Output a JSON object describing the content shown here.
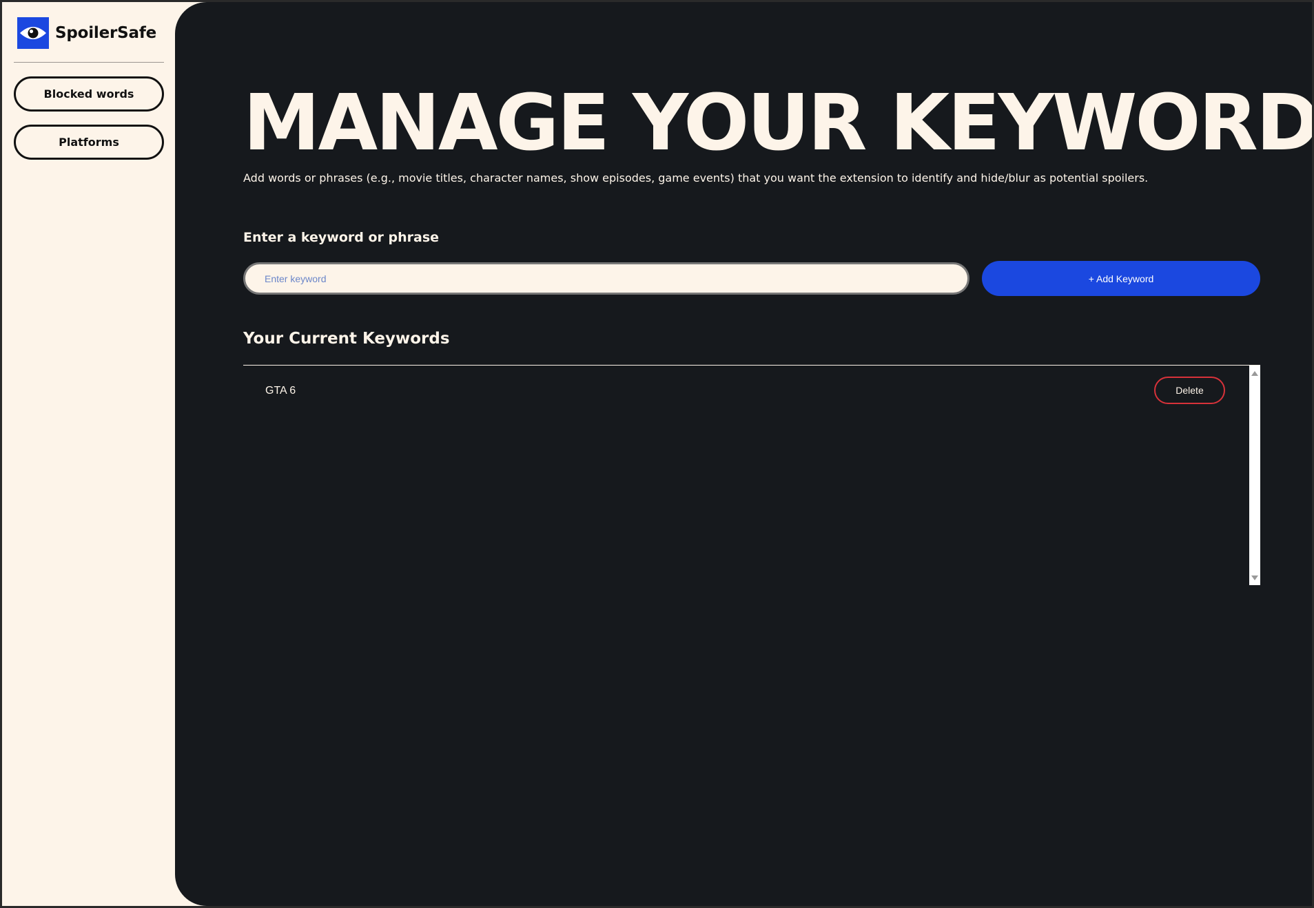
{
  "app": {
    "name": "SpoilerSafe",
    "logo_icon": "eye-icon",
    "accent_color": "#1b48e0",
    "danger_color": "#d8323a",
    "cream_color": "#fdf4e9",
    "panel_color": "#16191d"
  },
  "sidebar": {
    "items": [
      {
        "label": "Blocked words"
      },
      {
        "label": "Platforms"
      }
    ]
  },
  "main": {
    "title": "MANAGE YOUR KEYWORDS",
    "description": "Add words or phrases (e.g., movie titles, character names, show episodes, game events) that you want the extension to identify and hide/blur as potential spoilers.",
    "input_label": "Enter a keyword or phrase",
    "input_placeholder": "Enter keyword",
    "input_value": "",
    "add_button": "+ Add Keyword",
    "list_title": "Your Current Keywords",
    "keywords": [
      {
        "text": "GTA 6",
        "delete_label": "Delete"
      }
    ]
  }
}
